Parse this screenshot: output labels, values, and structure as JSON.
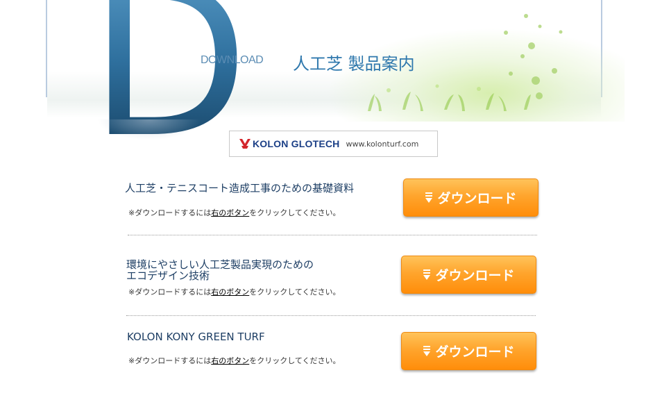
{
  "header": {
    "big_letter": "D",
    "download_word": "DOWNLOAD",
    "title": "人工芝 製品案内"
  },
  "logo": {
    "brand": "KOLON GLOTECH",
    "url": "www.kolonturf.com"
  },
  "items": [
    {
      "title_lines": [
        "人工芝・テニスコート造成工事のための基礎資料"
      ],
      "note_prefix": "※ダウンロードするには",
      "note_link": "右のボタン",
      "note_suffix": "をクリックしてください。",
      "button_label": "ダウンロード"
    },
    {
      "title_lines": [
        "環境にやさしい人工芝製品実現のための",
        "エコデザイン技術"
      ],
      "note_prefix": "※ダウンロードするには",
      "note_link": "右のボタン",
      "note_suffix": "をクリックしてください。",
      "button_label": "ダウンロード"
    },
    {
      "title_lines": [
        "KOLON KONY GREEN TURF"
      ],
      "note_prefix": "※ダウンロードするには",
      "note_link": "右のボタン",
      "note_suffix": "をクリックしてください。",
      "button_label": "ダウンロード"
    }
  ],
  "colors": {
    "accent": "#2f78ad",
    "button": "#ffa52d",
    "title_text": "#1d3e64"
  }
}
